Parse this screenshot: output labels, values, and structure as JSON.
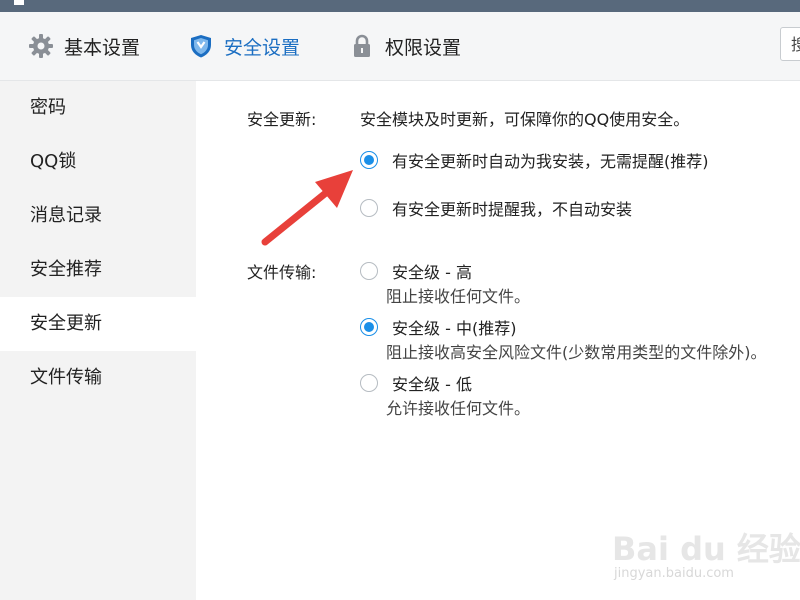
{
  "tabs": [
    {
      "label": "基本设置",
      "icon": "gear-icon"
    },
    {
      "label": "安全设置",
      "icon": "shield-icon"
    },
    {
      "label": "权限设置",
      "icon": "lock-icon"
    }
  ],
  "search": {
    "value": "搜"
  },
  "sidebar": {
    "items": [
      {
        "label": "密码"
      },
      {
        "label": "QQ锁"
      },
      {
        "label": "消息记录"
      },
      {
        "label": "安全推荐"
      },
      {
        "label": "安全更新"
      },
      {
        "label": "文件传输"
      }
    ],
    "active": "安全更新"
  },
  "security_update": {
    "label": "安全更新:",
    "description": "安全模块及时更新，可保障你的QQ使用安全。",
    "options": [
      {
        "label": "有安全更新时自动为我安装，无需提醒(推荐)",
        "checked": true
      },
      {
        "label": "有安全更新时提醒我，不自动安装",
        "checked": false
      }
    ]
  },
  "file_transfer": {
    "label": "文件传输:",
    "options": [
      {
        "label": "安全级 - 高",
        "sub": "阻止接收任何文件。",
        "checked": false
      },
      {
        "label": "安全级 - 中(推荐)",
        "sub": "阻止接收高安全风险文件(少数常用类型的文件除外)。",
        "checked": true
      },
      {
        "label": "安全级 - 低",
        "sub": "允许接收任何文件。",
        "checked": false
      }
    ]
  },
  "watermark": {
    "text": "Bai du 经验",
    "sub": "jingyan.baidu.com"
  },
  "colors": {
    "accent": "#1a8fe8",
    "active_tab": "#1b6ec2",
    "arrow": "#e8403a"
  }
}
